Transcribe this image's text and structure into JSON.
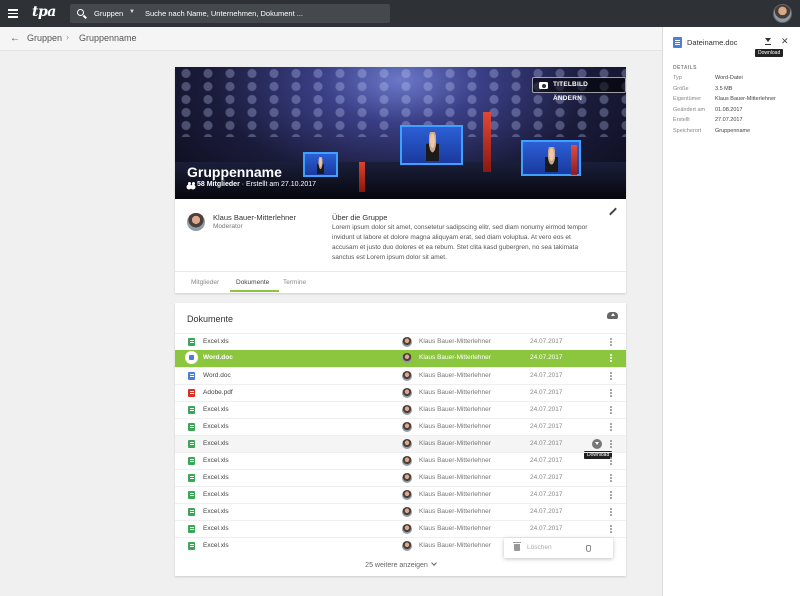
{
  "topbar": {
    "logo": "tpa",
    "search_scope": "Gruppen",
    "search_placeholder": "Suche nach Name, Unternehmen, Dokument ..."
  },
  "breadcrumb": {
    "parent": "Gruppen",
    "current": "Gruppenname"
  },
  "group": {
    "change_cover_label": "TITELBILD ÄNDERN",
    "name": "Gruppenname",
    "members": "58 Mitglieder",
    "created": "· Erstellt am 27.10.2017",
    "moderator_name": "Klaus Bauer-Mitterlehner",
    "moderator_role": "Moderator",
    "about_title": "Über die Gruppe",
    "about_text": "Lorem ipsum dolor sit amet, consetetur sadipscing elitr, sed diam nonumy eirmod tempor invidunt ut labore et dolore magna aliquyam erat, sed diam voluptua. At vero eos et accusam et justo duo dolores et ea rebum. Stet clita kasd gubergren, no sea takimata sanctus est Lorem ipsum dolor sit amet.",
    "tabs": [
      "Mitglieder",
      "Dokumente",
      "Termine"
    ]
  },
  "documents": {
    "title": "Dokumente",
    "rows": [
      {
        "name": "Excel.xls",
        "owner": "Klaus Bauer-Mitterlehner",
        "date": "24.07.2017",
        "type": "xls"
      },
      {
        "name": "Word.doc",
        "owner": "Klaus Bauer-Mitterlehner",
        "date": "24.07.2017",
        "type": "doc"
      },
      {
        "name": "Word.doc",
        "owner": "Klaus Bauer-Mitterlehner",
        "date": "24.07.2017",
        "type": "doc"
      },
      {
        "name": "Adobe.pdf",
        "owner": "Klaus Bauer-Mitterlehner",
        "date": "24.07.2017",
        "type": "pdf"
      },
      {
        "name": "Excel.xls",
        "owner": "Klaus Bauer-Mitterlehner",
        "date": "24.07.2017",
        "type": "xls"
      },
      {
        "name": "Excel.xls",
        "owner": "Klaus Bauer-Mitterlehner",
        "date": "24.07.2017",
        "type": "xls"
      },
      {
        "name": "Excel.xls",
        "owner": "Klaus Bauer-Mitterlehner",
        "date": "24.07.2017",
        "type": "xls"
      },
      {
        "name": "Excel.xls",
        "owner": "Klaus Bauer-Mitterlehner",
        "date": "24.07.2017",
        "type": "xls"
      },
      {
        "name": "Excel.xls",
        "owner": "Klaus Bauer-Mitterlehner",
        "date": "24.07.2017",
        "type": "xls"
      },
      {
        "name": "Excel.xls",
        "owner": "Klaus Bauer-Mitterlehner",
        "date": "24.07.2017",
        "type": "xls"
      },
      {
        "name": "Excel.xls",
        "owner": "Klaus Bauer-Mitterlehner",
        "date": "24.07.2017",
        "type": "xls"
      },
      {
        "name": "Excel.xls",
        "owner": "Klaus Bauer-Mitterlehner",
        "date": "24.07.2017",
        "type": "xls"
      },
      {
        "name": "Excel.xls",
        "owner": "Klaus Bauer-Mitterlehner",
        "date": "24.07.2017",
        "type": "xls"
      }
    ],
    "selected_index": 1,
    "hover_index": 6,
    "row_tooltip": "Download",
    "context_menu_item": "Löschen",
    "show_more": "25 weitere anzeigen",
    "file_colors": {
      "xls": "#3aa757",
      "doc": "#4a7fd6",
      "pdf": "#d93025"
    }
  },
  "details": {
    "file_name": "Dateiname.doc",
    "download_tooltip": "Download",
    "heading": "DETAILS",
    "fields": [
      {
        "key": "Typ",
        "value": "Word-Datei"
      },
      {
        "key": "Größe",
        "value": "3.5 MB"
      },
      {
        "key": "Eigentümer",
        "value": "Klaus Bauer-Mitterlehner"
      },
      {
        "key": "Geändert am",
        "value": "01.08.2017"
      },
      {
        "key": "Erstellt",
        "value": "27.07.2017"
      },
      {
        "key": "Speicherort",
        "value": "Gruppenname"
      }
    ]
  },
  "colors": {
    "accent": "#8cc63f",
    "topbar": "#2e3236"
  }
}
